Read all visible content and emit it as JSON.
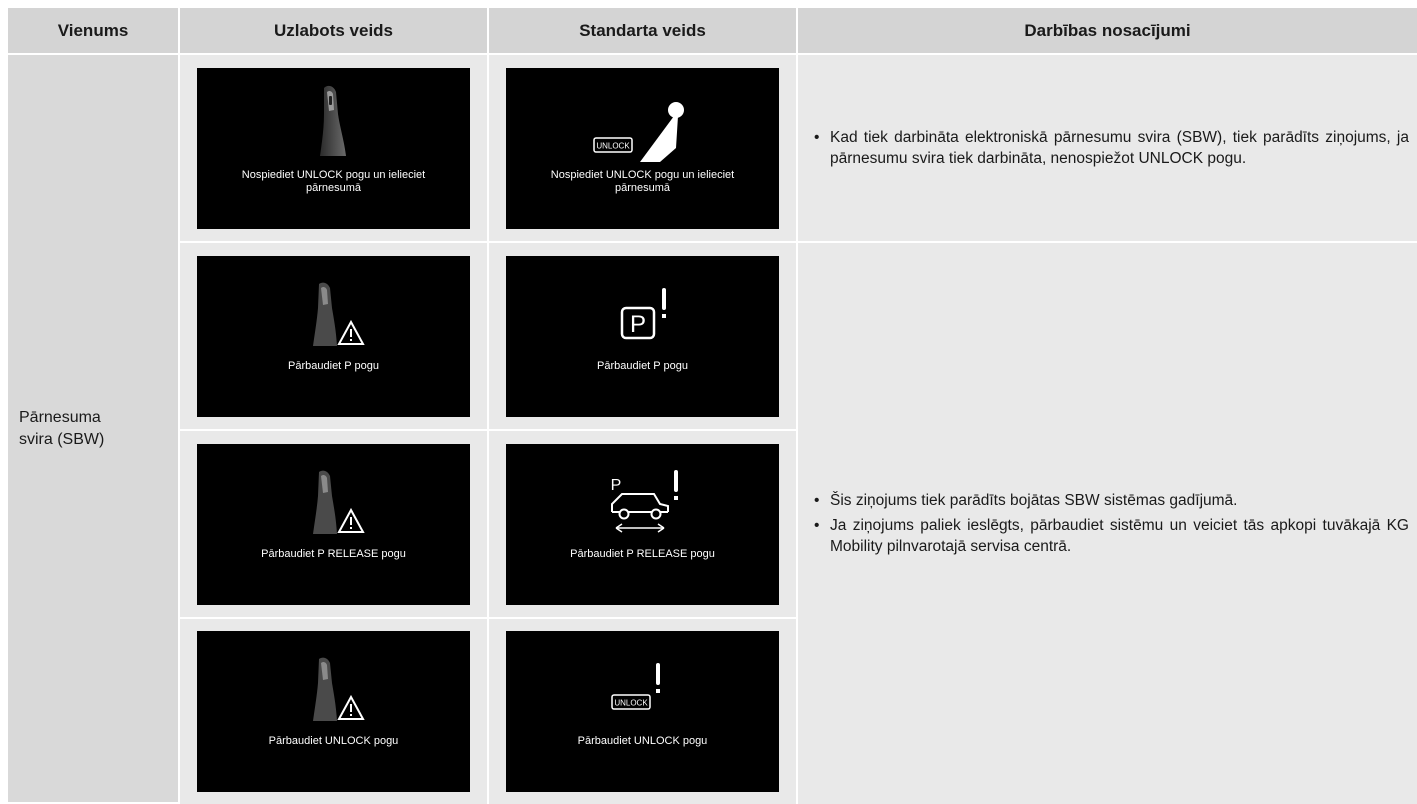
{
  "headers": {
    "item": "Vienums",
    "enhanced": "Uzlabots veids",
    "standard": "Standarta veids",
    "conditions": "Darbības nosacījumi"
  },
  "item": {
    "line1": "Pārnesuma",
    "line2": "svira (SBW)"
  },
  "rows": [
    {
      "enhanced_msg": "Nospiediet UNLOCK pogu un ielieciet pārnesumā",
      "standard_msg": "Nospiediet UNLOCK pogu un ielieciet pārnesumā",
      "standard_icon_text": "UNLOCK"
    },
    {
      "enhanced_msg": "Pārbaudiet P pogu",
      "standard_msg": "Pārbaudiet P pogu",
      "standard_icon_text": "P"
    },
    {
      "enhanced_msg": "Pārbaudiet P RELEASE pogu",
      "standard_msg": "Pārbaudiet P RELEASE pogu",
      "standard_icon_text": "P"
    },
    {
      "enhanced_msg": "Pārbaudiet UNLOCK pogu",
      "standard_msg": "Pārbaudiet UNLOCK pogu",
      "standard_icon_text": "UNLOCK"
    }
  ],
  "conditions": {
    "top": [
      "Kad tiek darbināta elektroniskā pārnesumu svira (SBW), tiek parādīts ziņojums, ja pārnesumu svira tiek darbināta, nenospiežot UNLOCK pogu."
    ],
    "bottom": [
      "Šis ziņojums tiek parādīts bojātas SBW sistēmas gadījumā.",
      "Ja ziņojums paliek ieslēgts, pārbaudiet sistēmu un veiciet tās apkopi tuvākajā KG Mobility pilnvarotajā servisa centrā."
    ]
  },
  "icons": {
    "enhanced": "gear-lever-icon",
    "warning": "warning-triangle-icon",
    "standard_row1": "unlock-gear-shift-icon",
    "standard_row2": "park-button-warning-icon",
    "standard_row3": "car-park-release-warning-icon",
    "standard_row4": "unlock-warning-icon"
  }
}
